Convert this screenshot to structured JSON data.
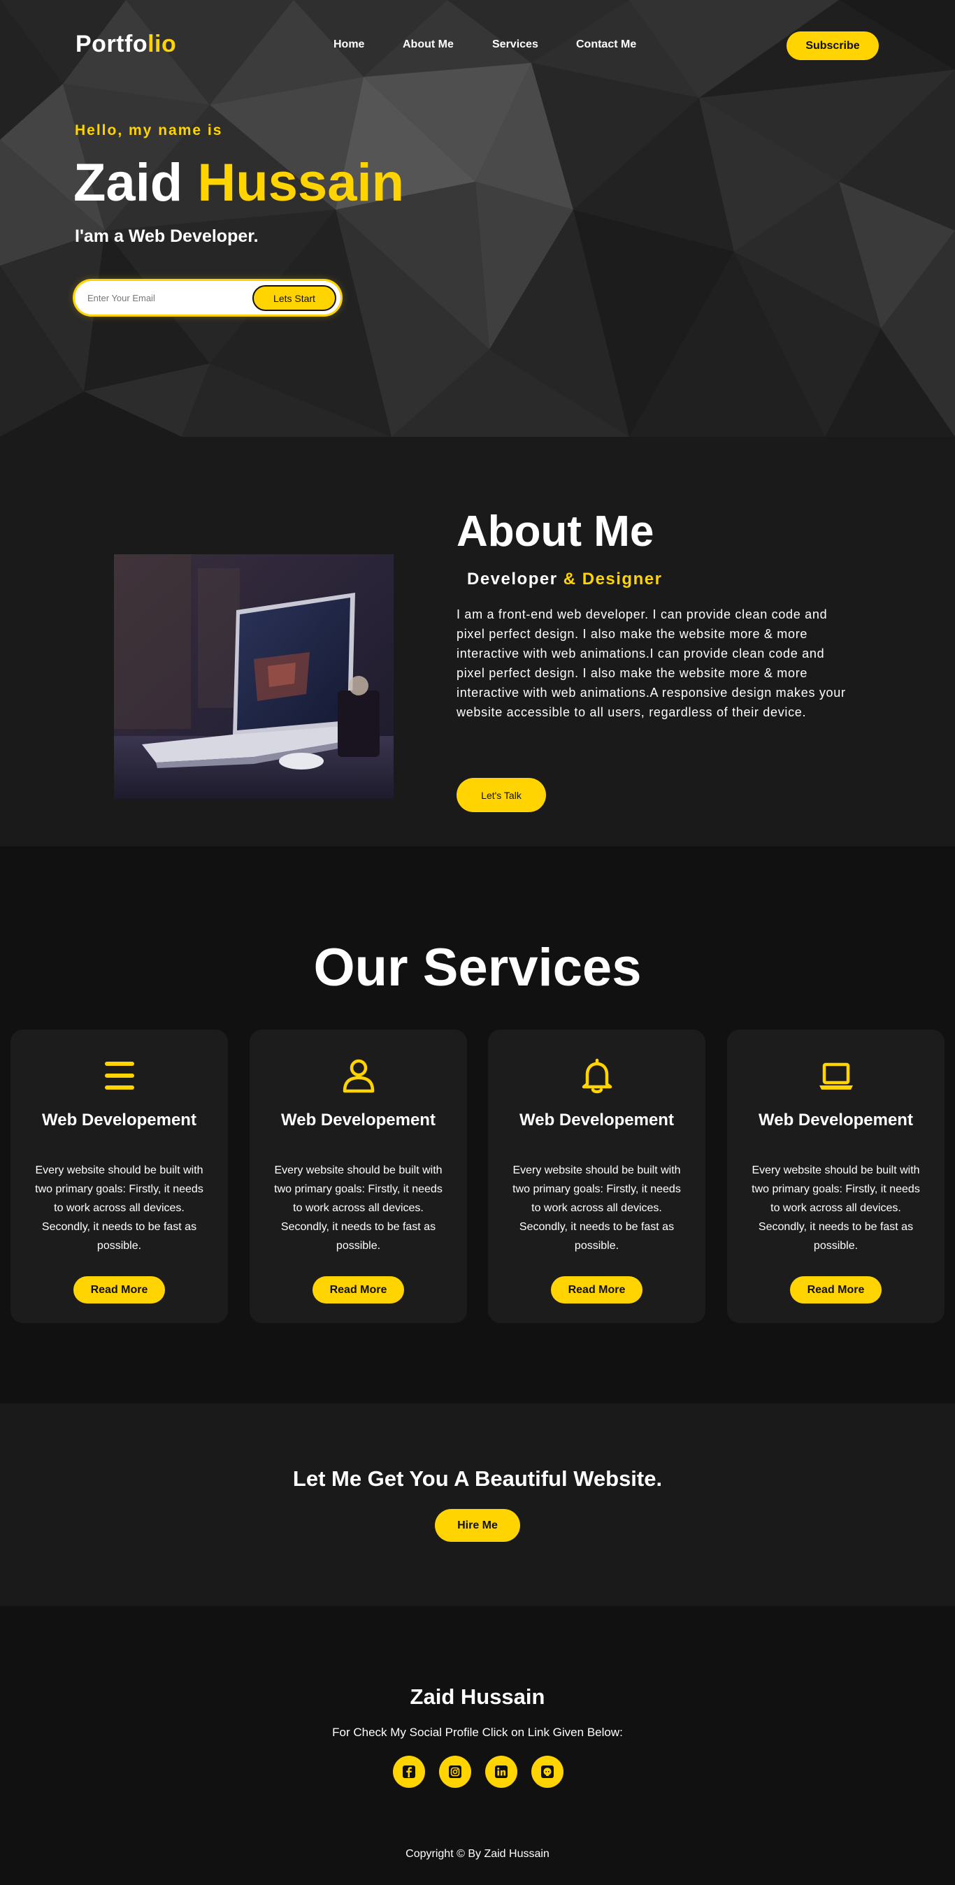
{
  "colors": {
    "accent": "#ffd400",
    "background": "#111111",
    "section": "#1a1a1a",
    "card": "#1c1c1c"
  },
  "nav": {
    "logo_main": "Portfo",
    "logo_accent": "lio",
    "links": [
      "Home",
      "About Me",
      "Services",
      "Contact Me"
    ],
    "subscribe": "Subscribe"
  },
  "hero": {
    "greeting": "Hello, my name is",
    "first_name": "Zaid",
    "last_name": "Hussain",
    "role": "I'am a Web Developer.",
    "email_placeholder": "Enter Your Email",
    "cta": "Lets Start"
  },
  "about": {
    "title": "About Me",
    "subtitle_main": "Developer",
    "subtitle_accent": "& Designer",
    "text": "I am a front-end web developer. I can provide clean code and pixel perfect design. I also make the website more & more interactive with web animations.I can provide clean code and pixel perfect design. I also make the website more & more interactive with web animations.A responsive design makes your website accessible to all users, regardless of their device.",
    "cta": "Let's Talk"
  },
  "services": {
    "title": "Our Services",
    "cards": [
      {
        "icon": "menu-icon",
        "title": "Web Developement",
        "text": "Every website should be built with two primary goals: Firstly, it needs to work across all devices. Secondly, it needs to be fast as possible.",
        "button": "Read More"
      },
      {
        "icon": "user-icon",
        "title": "Web Developement",
        "text": "Every website should be built with two primary goals: Firstly, it needs to work across all devices. Secondly, it needs to be fast as possible.",
        "button": "Read More"
      },
      {
        "icon": "bell-icon",
        "title": "Web Developement",
        "text": "Every website should be built with two primary goals: Firstly, it needs to work across all devices. Secondly, it needs to be fast as possible.",
        "button": "Read More"
      },
      {
        "icon": "laptop-icon",
        "title": "Web Developement",
        "text": "Every website should be built with two primary goals: Firstly, it needs to work across all devices. Secondly, it needs to be fast as possible.",
        "button": "Read More"
      }
    ]
  },
  "cta": {
    "title": "Let Me Get You A Beautiful Website.",
    "button": "Hire Me"
  },
  "footer": {
    "name": "Zaid Hussain",
    "text": "For Check My Social Profile Click on Link Given Below:",
    "socials": [
      "facebook-icon",
      "instagram-icon",
      "linkedin-icon",
      "github-icon"
    ],
    "copyright": "Copyright © By Zaid Hussain"
  }
}
